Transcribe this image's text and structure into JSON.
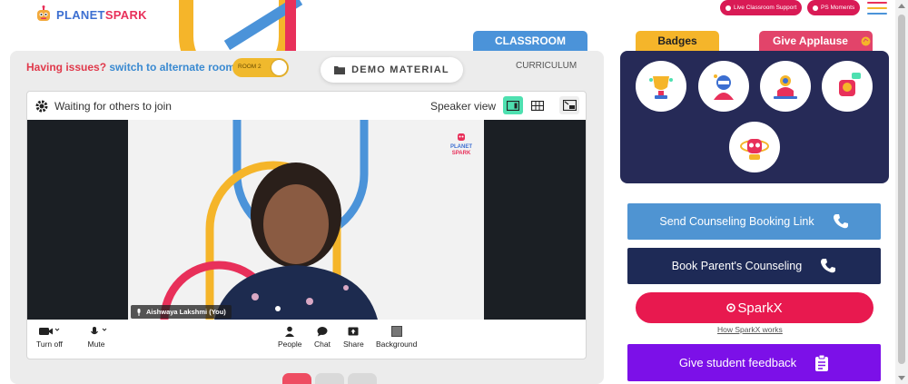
{
  "brand": {
    "name_part1": "PLANET",
    "name_part2": "SPARK"
  },
  "header": {
    "live_support": "Live Classroom Support",
    "ps_moments": "PS Moments"
  },
  "classroom": {
    "tab_classroom": "CLASSROOM",
    "tab_curriculum": "CURRICULUM",
    "issues_text": "Having issues?",
    "switch_link": "switch to alternate room",
    "room_label": "ROOM 2",
    "demo_material": "DEMO MATERIAL"
  },
  "video": {
    "status": "Waiting for others to join",
    "speaker_view": "Speaker view",
    "participant_name": "Aishwaya Lakshmi (You)",
    "feed_logo_line1": "PLANET",
    "feed_logo_line2": "SPARK",
    "controls": {
      "turn_off": "Turn off",
      "mute": "Mute",
      "people": "People",
      "chat": "Chat",
      "share": "Share",
      "background": "Background"
    }
  },
  "sidebar": {
    "tab_badges": "Badges",
    "tab_applause": "Give Applause",
    "badges": [
      "trophy-badge-icon",
      "hero-badge-icon",
      "rocket-badge-icon",
      "idea-badge-icon",
      "robot-badge-icon"
    ],
    "send_counseling": "Send Counseling Booking Link",
    "book_parent": "Book Parent's Counseling",
    "sparkx": "SparkX",
    "sparkx_link": "How SparkX works",
    "give_feedback": "Give student feedback"
  },
  "colors": {
    "accent_blue": "#4b93d9",
    "accent_pink": "#e8194f",
    "badges_bg": "#262a57",
    "badges_tab": "#f5b52a",
    "feedback_purple": "#7c10e8",
    "navy": "#1e2a56"
  }
}
